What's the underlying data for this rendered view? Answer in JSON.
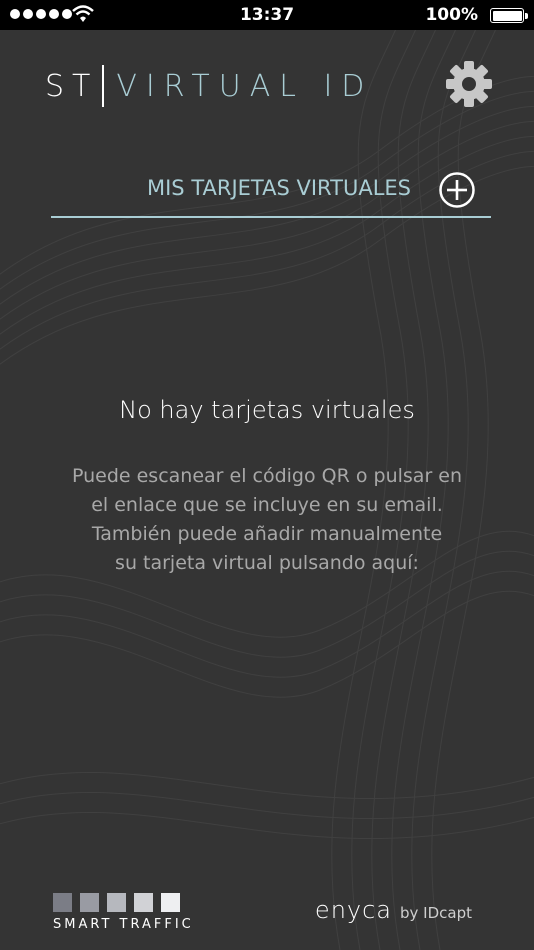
{
  "status_bar": {
    "time": "13:37",
    "battery": "100%"
  },
  "header": {
    "logo_prefix": "ST",
    "logo_name": "VIRTUAL ID",
    "settings_icon": "gear-icon"
  },
  "cards_section": {
    "title": "MIS TARJETAS VIRTUALES",
    "add_icon": "plus-circle-icon"
  },
  "empty_state": {
    "title": "No hay tarjetas virtuales",
    "lines": [
      "Puede escanear el código QR o pulsar en",
      "el enlace que se incluye en su email.",
      "También puede añadir manualmente",
      "su tarjeta virtual pulsando aquí:"
    ]
  },
  "footer": {
    "left_brand": "SMART TRAFFIC",
    "left_square_colors": [
      "#7b7d86",
      "#999ba3",
      "#b6b8be",
      "#d1d2d6",
      "#eeeff1"
    ],
    "right_brand": "enyca",
    "right_by": "by IDcapt"
  },
  "colors": {
    "accent": "#a9cdd4",
    "background": "#343434"
  }
}
